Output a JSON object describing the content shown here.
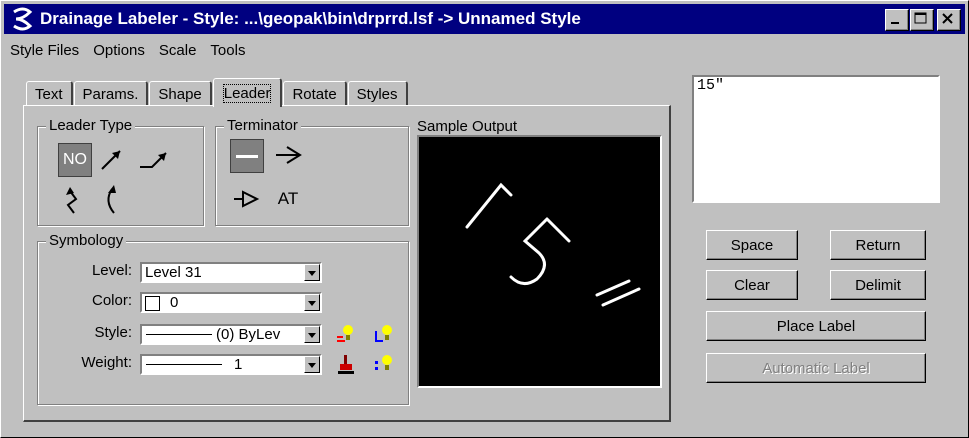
{
  "window": {
    "title": "Drainage Labeler - Style: ...\\geopak\\bin\\drprrd.lsf -> Unnamed Style"
  },
  "menu": [
    "Style Files",
    "Options",
    "Scale",
    "Tools"
  ],
  "tabs": [
    "Text",
    "Params.",
    "Shape",
    "Leader",
    "Rotate",
    "Styles"
  ],
  "active_tab": "Leader",
  "leader_type": {
    "label": "Leader Type",
    "no_label": "NO",
    "selected": "NO"
  },
  "terminator": {
    "label": "Terminator",
    "at_label": "AT",
    "selected": "none"
  },
  "sample_output": {
    "label": "Sample Output",
    "text": "15\""
  },
  "symbology": {
    "label": "Symbology",
    "level_label": "Level:",
    "level_value": "Level 31",
    "color_label": "Color:",
    "color_value": "0",
    "style_label": "Style:",
    "style_value": "(0) ByLev",
    "weight_label": "Weight:",
    "weight_value": "1"
  },
  "label_text": "15\"",
  "buttons": {
    "space": "Space",
    "return": "Return",
    "clear": "Clear",
    "delimit": "Delimit",
    "place_label": "Place Label",
    "automatic_label": "Automatic Label"
  },
  "colors": {
    "titlebar": "#000080",
    "face": "#c0c0c0",
    "sample_bg": "#000000"
  }
}
